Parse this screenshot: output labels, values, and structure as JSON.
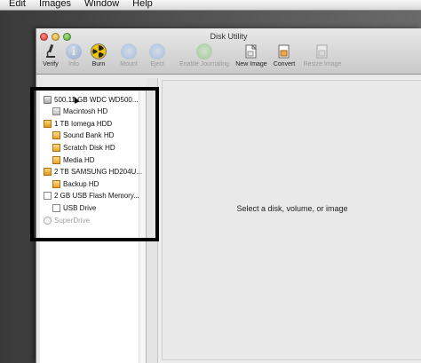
{
  "menubar": {
    "items": [
      "Edit",
      "Images",
      "Window",
      "Help"
    ]
  },
  "window": {
    "title": "Disk Utility"
  },
  "toolbar": {
    "items": [
      {
        "label": "Verify",
        "icon": "microscope-icon",
        "enabled": true
      },
      {
        "label": "Info",
        "icon": "info-icon",
        "enabled": false
      },
      {
        "label": "Burn",
        "icon": "burn-icon",
        "enabled": true
      },
      {
        "label": "Mount",
        "icon": "mount-icon",
        "enabled": false
      },
      {
        "label": "Eject",
        "icon": "eject-icon",
        "enabled": false
      },
      {
        "label": "Enable Journaling",
        "icon": "journal-icon",
        "enabled": false
      },
      {
        "label": "New Image",
        "icon": "new-image-icon",
        "enabled": true
      },
      {
        "label": "Convert",
        "icon": "convert-icon",
        "enabled": true
      },
      {
        "label": "Resize Image",
        "icon": "resize-image-icon",
        "enabled": false
      }
    ]
  },
  "sidebar": {
    "items": [
      {
        "label": "500.11 GB WDC WD500...",
        "kind": "disk",
        "level": 0
      },
      {
        "label": "Macintosh HD",
        "kind": "volume",
        "level": 1
      },
      {
        "label": "1 TB Iomega HDD",
        "kind": "external-disk",
        "level": 0
      },
      {
        "label": "Sound Bank HD",
        "kind": "external-volume",
        "level": 1
      },
      {
        "label": "Scratch Disk HD",
        "kind": "external-volume",
        "level": 1
      },
      {
        "label": "Media HD",
        "kind": "external-volume",
        "level": 1
      },
      {
        "label": "2 TB SAMSUNG HD204U...",
        "kind": "external-disk",
        "level": 0
      },
      {
        "label": "Backup HD",
        "kind": "external-volume",
        "level": 1
      },
      {
        "label": "2 GB USB Flash Memory...",
        "kind": "usb-disk",
        "level": 0
      },
      {
        "label": "USB Drive",
        "kind": "usb-volume",
        "level": 1
      },
      {
        "label": "SuperDrive",
        "kind": "superdrive",
        "level": 0,
        "muted": true
      }
    ]
  },
  "main": {
    "empty_message": "Select a disk, volume, or image"
  },
  "colors": {
    "annotation_box": "#000000",
    "desktop": "#3a3a3a"
  }
}
